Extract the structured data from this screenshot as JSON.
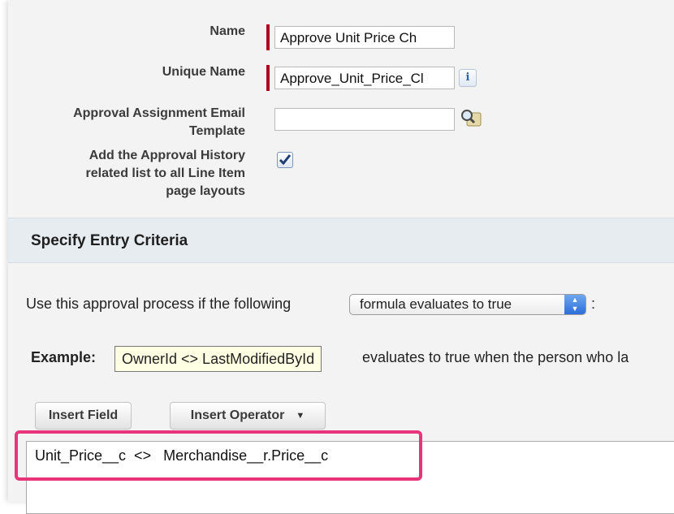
{
  "form": {
    "name_label": "Name",
    "name_value": "Approve Unit Price Ch",
    "unique_name_label": "Unique Name",
    "unique_name_value": "Approve_Unit_Price_Cl",
    "info_icon": "i",
    "email_template_label_line1": "Approval Assignment Email",
    "email_template_label_line2": "Template",
    "email_template_value": "",
    "approval_history_label_line1": "Add the Approval History",
    "approval_history_label_line2": "related list to all Line Item",
    "approval_history_label_line3": "page layouts",
    "approval_history_checked": true
  },
  "entry_criteria": {
    "section_title": "Specify Entry Criteria",
    "use_text": "Use this approval process if the following",
    "select_value": "formula evaluates to true",
    "colon": ":",
    "example_label": "Example:",
    "example_code": "OwnerId <> LastModifiedById",
    "example_tail": "evaluates to true when the person who la",
    "insert_field_label": "Insert Field",
    "insert_operator_label": "Insert Operator",
    "formula_text": "Unit_Price__c  <>   Merchandise__r.Price__c"
  },
  "colors": {
    "required_bar": "#b00020",
    "highlight": "#e8357a",
    "section_bg": "#e7ecf1",
    "example_bg": "#ffffe3"
  },
  "icons": {
    "lookup": "magnifier-lookup-icon",
    "info": "info-icon",
    "select_arrows": "up-down-arrows-icon",
    "dropdown": "triangle-down-icon"
  }
}
